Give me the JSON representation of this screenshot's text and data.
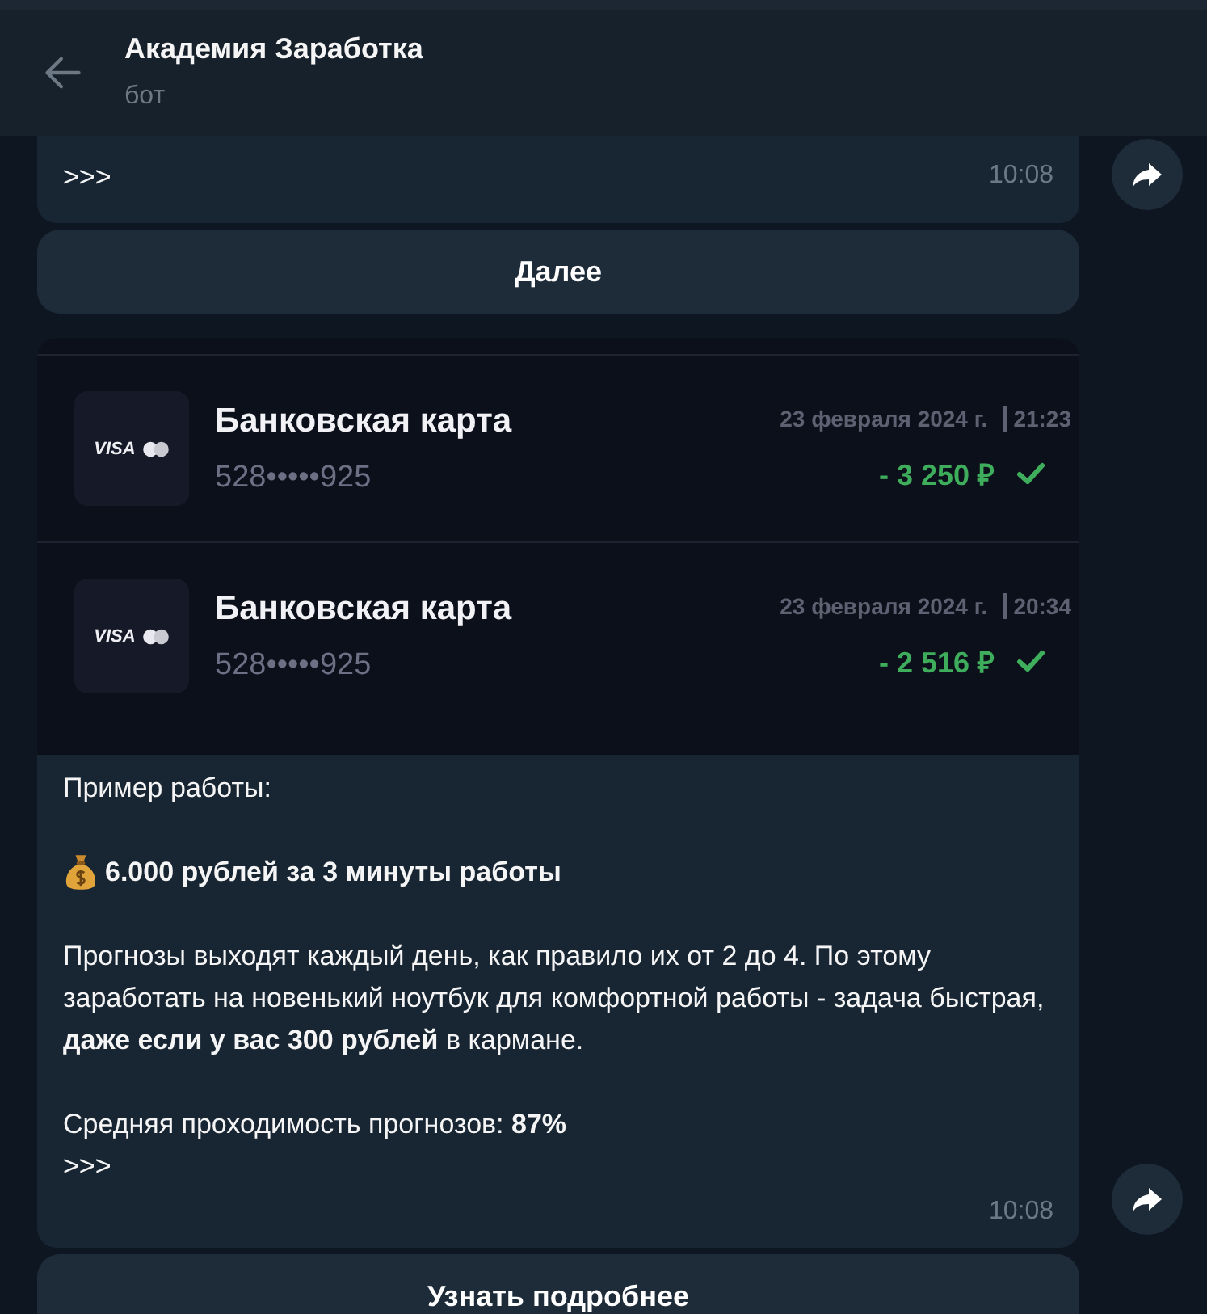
{
  "header": {
    "title": "Академия Заработка",
    "subtitle": "бот"
  },
  "messages": [
    {
      "lines": [
        ">>>"
      ],
      "time": "10:08",
      "button": "Далее"
    },
    {
      "image": {
        "kind": "screenshot",
        "transactions": [
          {
            "title": "Банковская карта",
            "card_brand": "VISA",
            "card_number": "528•••••925",
            "date": "23 февраля 2024 г.",
            "time": "21:23",
            "amount": "- 3 250 ₽",
            "confirmed": true
          },
          {
            "title": "Банковская карта",
            "card_brand": "VISA",
            "card_number": "528•••••925",
            "date": "23 февраля 2024 г.",
            "time": "20:34",
            "amount": "- 2 516 ₽",
            "confirmed": true
          }
        ]
      },
      "paragraphs": [
        {
          "kind": "plain",
          "text": "Пример работы:"
        },
        {
          "kind": "money",
          "text": "6.000 рублей за 3 минуты работы"
        },
        {
          "kind": "plain",
          "text": "Прогнозы выходят каждый день, как правило их от 2 до 4. По этому заработать на новенький ноутбук для комфортной работы - задача быстрая, **даже если у вас 300 рублей** в кармане."
        },
        {
          "kind": "plain",
          "text": "Средняя проходимость прогнозов: **87%**\n>>>"
        }
      ],
      "time": "10:08",
      "button": "Узнать подробнее"
    }
  ]
}
